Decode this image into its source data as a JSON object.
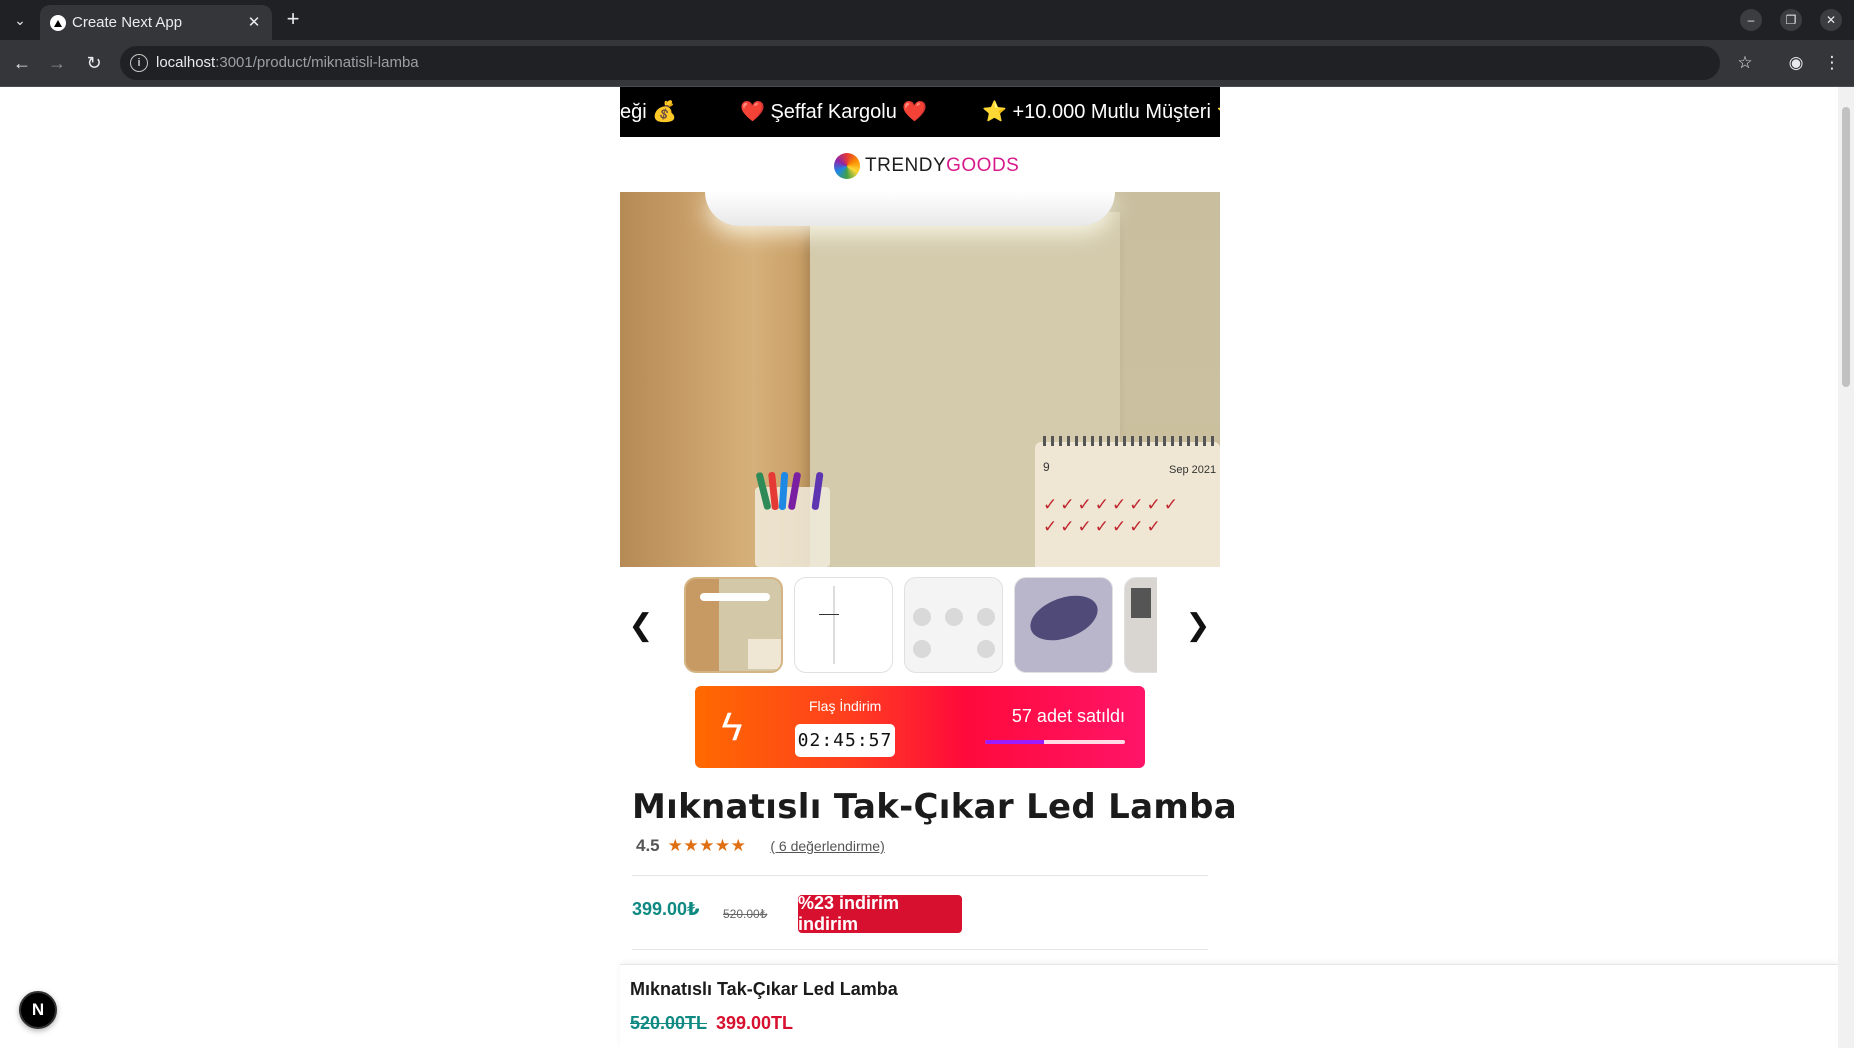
{
  "browser": {
    "tab_title": "Create Next App",
    "url_host": "localhost",
    "url_path": ":3001/product/miknatisli-lamba"
  },
  "marquee": {
    "items": [
      "eği 💰",
      "❤️ Şeffaf Kargolu ❤️",
      "⭐ +10.000 Mutlu Müşteri ⭐"
    ]
  },
  "logo": {
    "part1": "TRENDY",
    "part2": "GOODS",
    "accent": "#d81b8c"
  },
  "hero": {
    "calendar_label": "Sep 2021",
    "calendar_day": "9"
  },
  "gallery": {
    "prev_label": "❮",
    "next_label": "❯",
    "thumbnail_count_visible": 5
  },
  "flash_sale": {
    "label": "Flaş İndirim",
    "timer": "02:45:57",
    "sold_text": "57 adet satıldı",
    "progress_fraction": 0.42
  },
  "product": {
    "title": "Mıknatıslı Tak-Çıkar Led Lamba",
    "rating": "4.5",
    "stars": "★★★★★",
    "reviews_link": "( 6 değerlendirme)",
    "price": "399.00₺",
    "old_price": "520.00₺",
    "discount_badge": "%23 indirim indirim"
  },
  "sticky_bar": {
    "title": "Mıknatıslı Tak-Çıkar Led Lamba",
    "old_price": "520.00TL",
    "new_price": "399.00TL"
  },
  "next_badge": "N",
  "colors": {
    "price_green": "#0f8a82",
    "discount_red": "#d8102f",
    "star_orange": "#e06f12"
  }
}
